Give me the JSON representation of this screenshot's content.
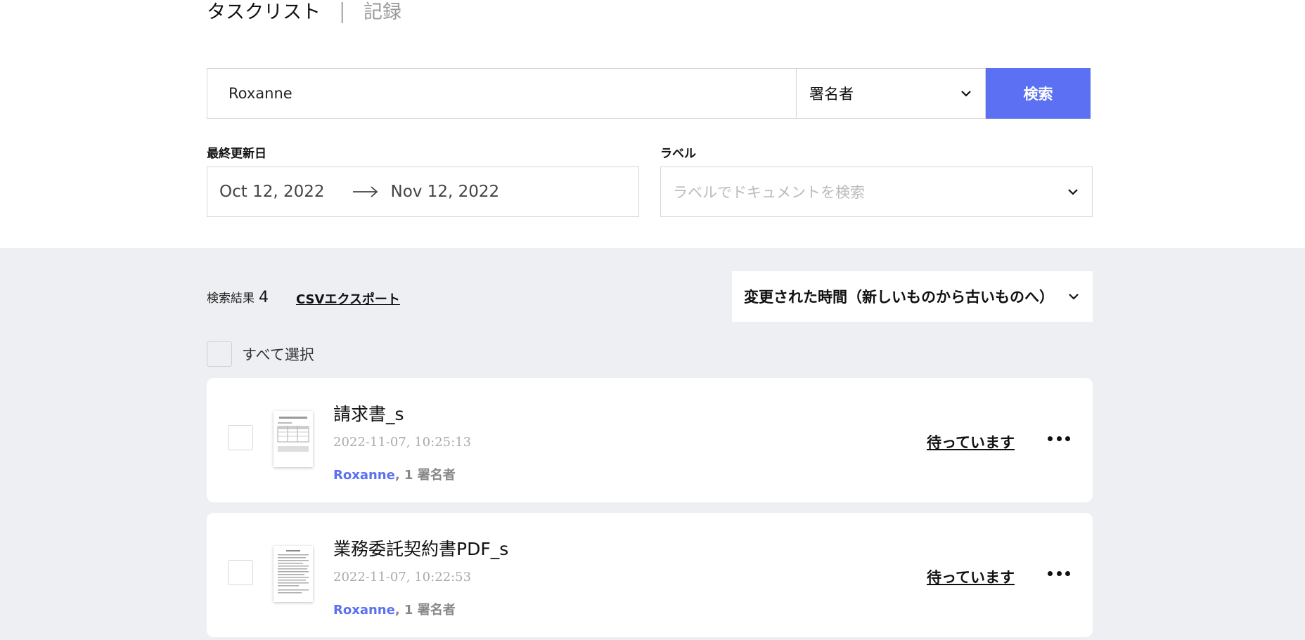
{
  "tabs": {
    "active": "タスクリスト",
    "other": "記録"
  },
  "search": {
    "value": "Roxanne",
    "filter_selected": "署名者",
    "button": "検索"
  },
  "filters": {
    "date_label": "最終更新日",
    "date_from": "Oct 12, 2022",
    "date_to": "Nov 12, 2022",
    "label_label": "ラベル",
    "label_placeholder": "ラベルでドキュメントを検索"
  },
  "results": {
    "label": "検索結果",
    "count": "4",
    "csv_export": "CSVエクスポート",
    "sort_selected": "変更された時間（新しいものから古いものへ）",
    "select_all": "すべて選択"
  },
  "documents": [
    {
      "title": "請求書_s",
      "date": "2022-11-07, 10:25:13",
      "signer_name": "Roxanne",
      "signer_count": ", 1 署名者",
      "status": "待っています"
    },
    {
      "title": "業務委託契約書PDF_s",
      "date": "2022-11-07, 10:22:53",
      "signer_name": "Roxanne",
      "signer_count": ", 1 署名者",
      "status": "待っています"
    }
  ],
  "colors": {
    "accent": "#5b70f2",
    "background_gray": "#eeeff3"
  },
  "icons": {
    "dropdown": "chevron-down-icon",
    "date_range": "arrow-right-icon",
    "menu": "more-horizontal-icon",
    "thumbnail": "document-thumbnail-icon"
  }
}
